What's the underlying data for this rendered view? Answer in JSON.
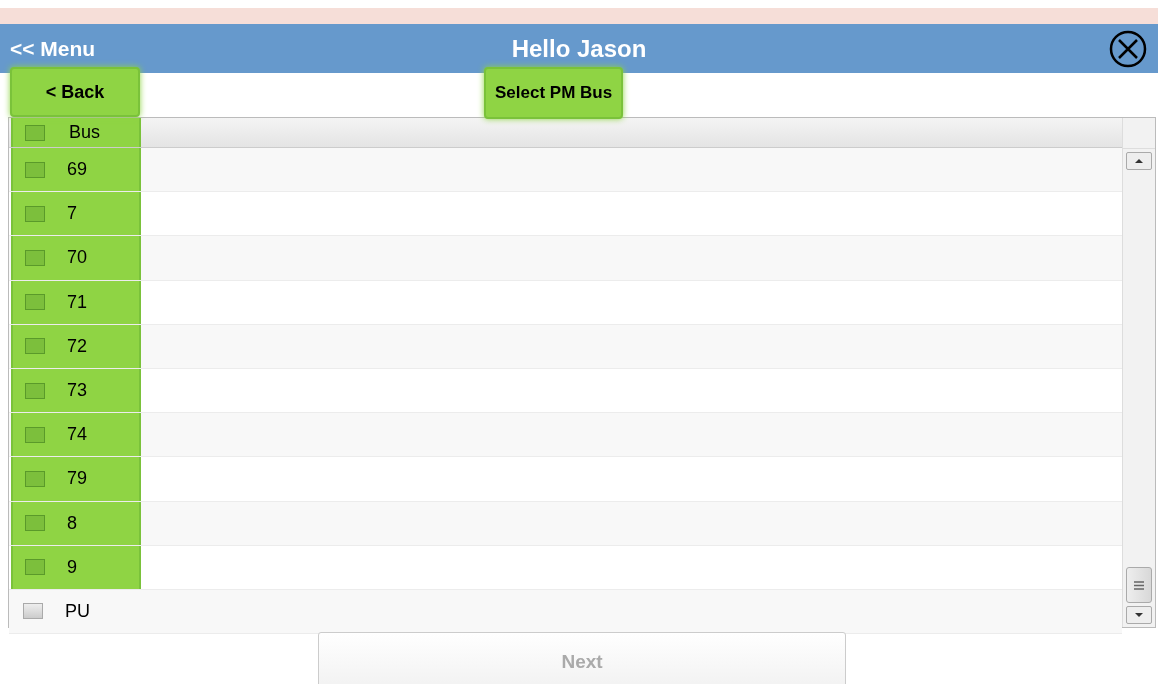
{
  "header": {
    "menu_link": "<< Menu",
    "title": "Hello Jason"
  },
  "back_button": {
    "label": "< Back",
    "highlighted": true
  },
  "page_title": {
    "label": "Select PM Bus",
    "highlighted": true
  },
  "table": {
    "columns": [
      "Bus"
    ],
    "header_checked": false,
    "header_highlighted": true,
    "rows": [
      {
        "bus": "69",
        "checked": false,
        "highlighted": true
      },
      {
        "bus": "7",
        "checked": false,
        "highlighted": true
      },
      {
        "bus": "70",
        "checked": false,
        "highlighted": true
      },
      {
        "bus": "71",
        "checked": false,
        "highlighted": true
      },
      {
        "bus": "72",
        "checked": false,
        "highlighted": true
      },
      {
        "bus": "73",
        "checked": false,
        "highlighted": true
      },
      {
        "bus": "74",
        "checked": false,
        "highlighted": true
      },
      {
        "bus": "79",
        "checked": false,
        "highlighted": true
      },
      {
        "bus": "8",
        "checked": false,
        "highlighted": true
      },
      {
        "bus": "9",
        "checked": false,
        "highlighted": true
      },
      {
        "bus": "PU",
        "checked": false,
        "highlighted": false
      }
    ]
  },
  "next_button": {
    "label": "Next",
    "disabled": true
  }
}
